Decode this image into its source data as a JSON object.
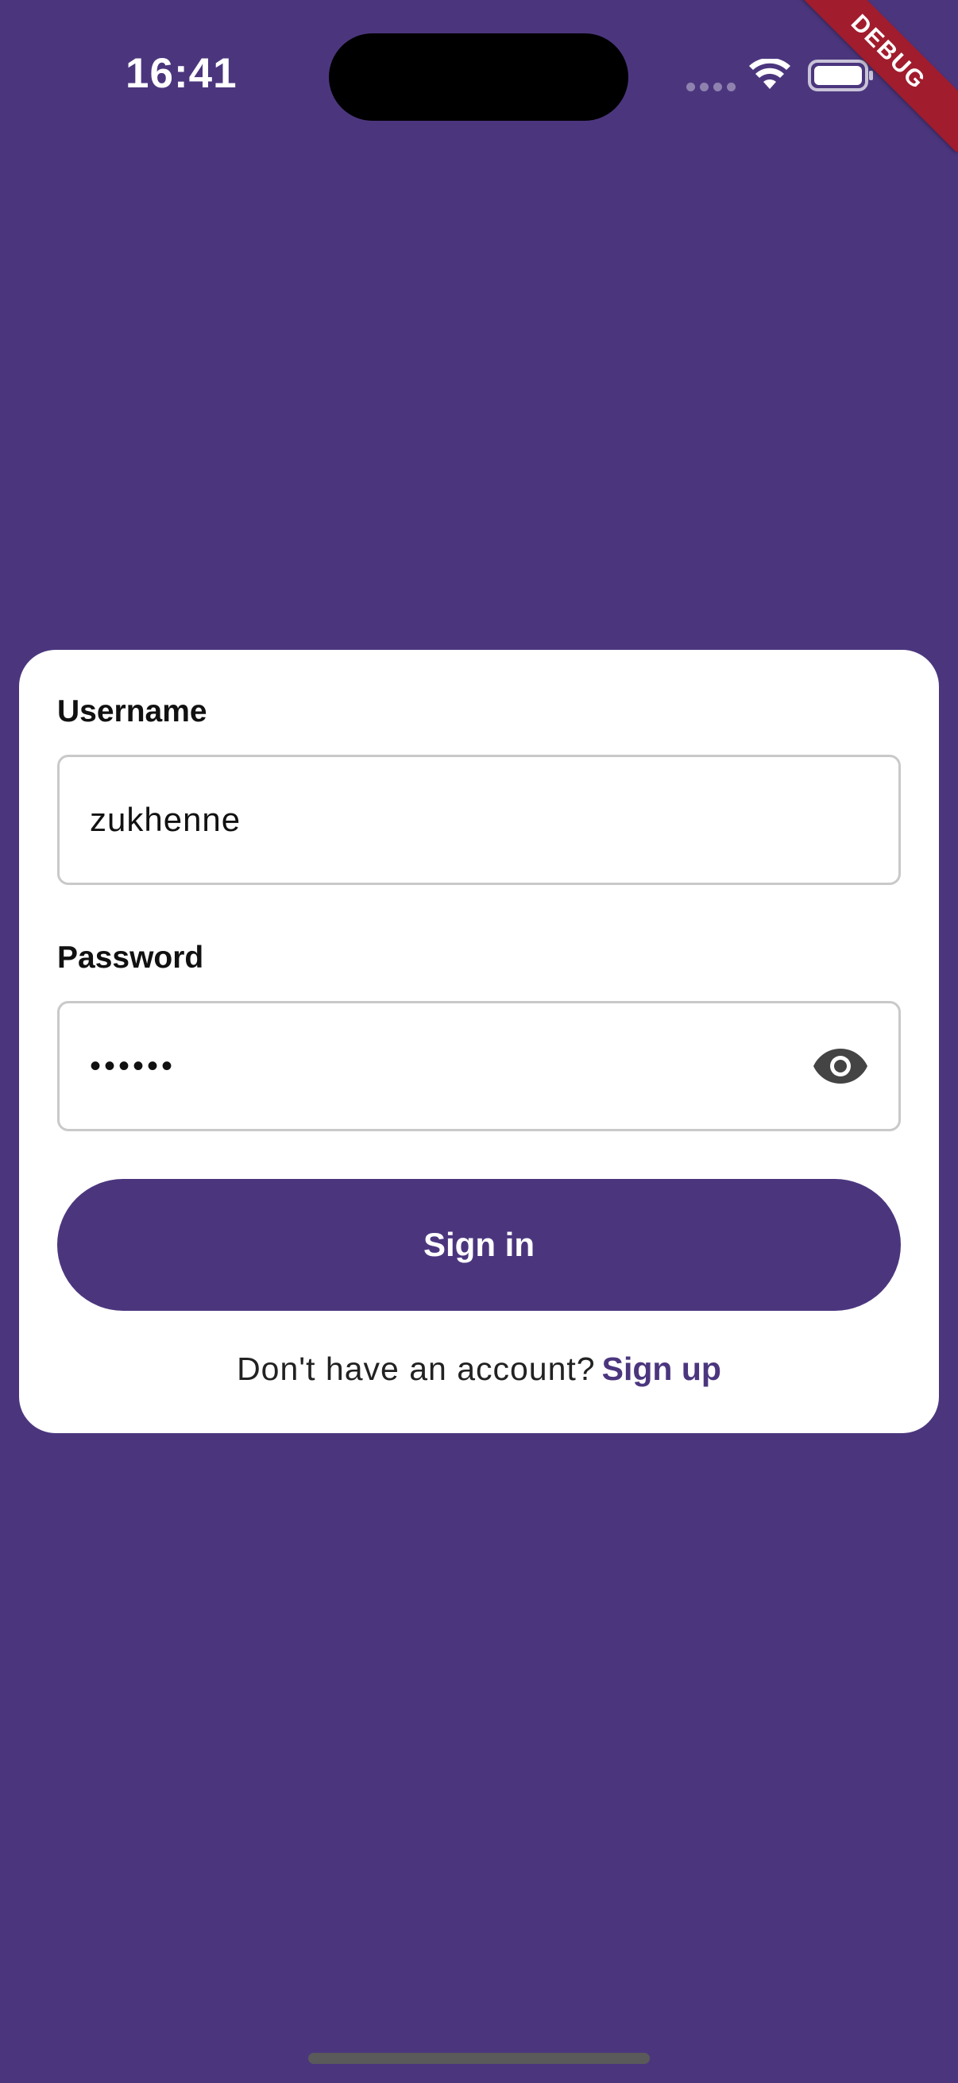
{
  "status_bar": {
    "time": "16:41",
    "wifi_icon": "wifi-icon",
    "battery_icon": "battery-icon"
  },
  "debug_banner": "DEBUG",
  "form": {
    "username_label": "Username",
    "username_value": "zukhenne",
    "password_label": "Password",
    "password_value": "••••••",
    "password_visibility_icon": "eye-icon",
    "sign_in_label": "Sign in",
    "signup_prompt": "Don't have an account?",
    "signup_link": "Sign up"
  },
  "colors": {
    "background": "#4b367e",
    "card": "#ffffff",
    "accent": "#4b367e",
    "debug_ribbon": "#a11c2d"
  }
}
